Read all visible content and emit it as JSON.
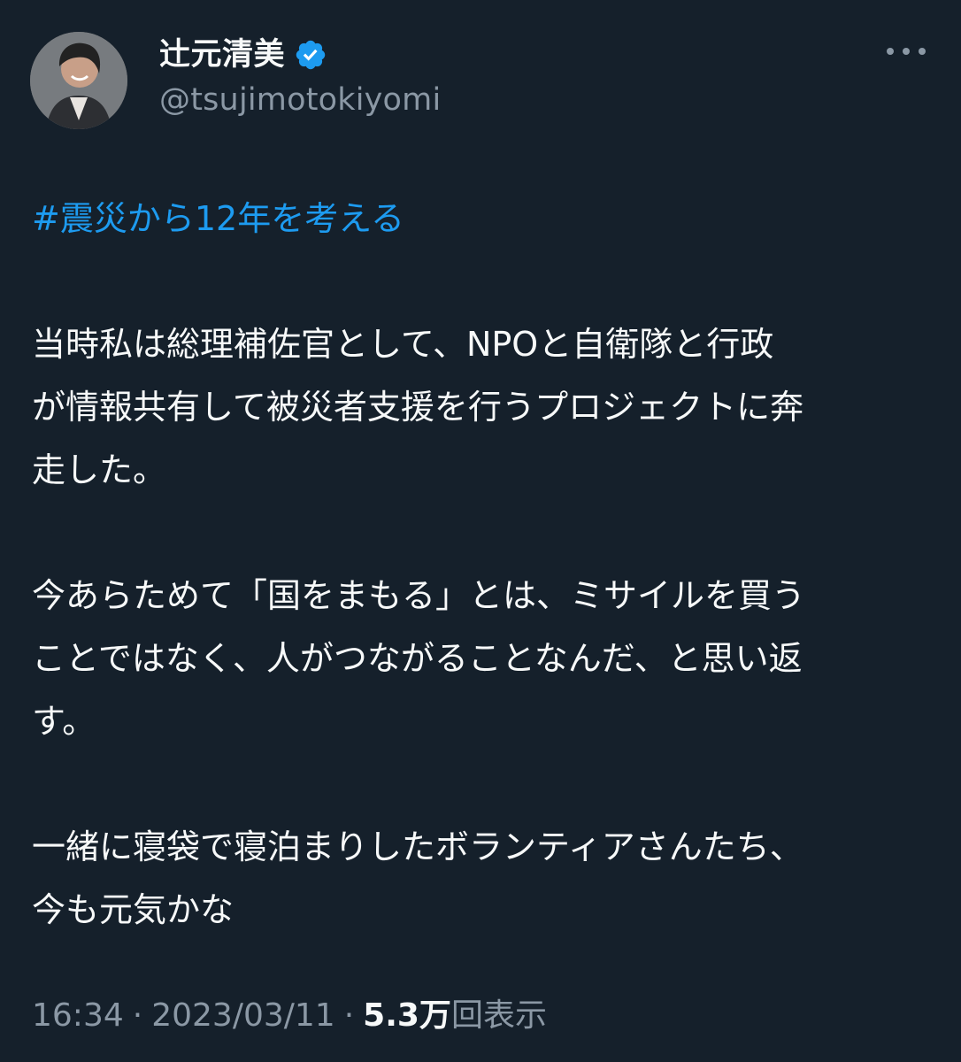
{
  "tweet": {
    "author": {
      "display_name": "辻元清美",
      "handle": "@tsujimotokiyomi",
      "verified": true
    },
    "hashtag": "#震災から12年を考える",
    "paragraphs": [
      "当時私は総理補佐官として、NPOと自衛隊と行政\nが情報共有して被災者支援を行うプロジェクトに奔\n走した。",
      "今あらためて「国をまもる」とは、ミサイルを買う\nことではなく、人がつながることなんだ、と思い返\nす。",
      "一緒に寝袋で寝泊まりしたボランティアさんたち、\n今も元気かな"
    ],
    "time": "16:34",
    "date": "2023/03/11",
    "separator": "·",
    "view_count": "5.3万",
    "view_label": "回表示"
  },
  "colors": {
    "background": "#15202b",
    "text": "#f7f9f9",
    "secondary": "#8b98a5",
    "accent": "#1d9bf0"
  },
  "icons": {
    "verified": "verified-badge-icon",
    "more": "more-options-icon"
  }
}
